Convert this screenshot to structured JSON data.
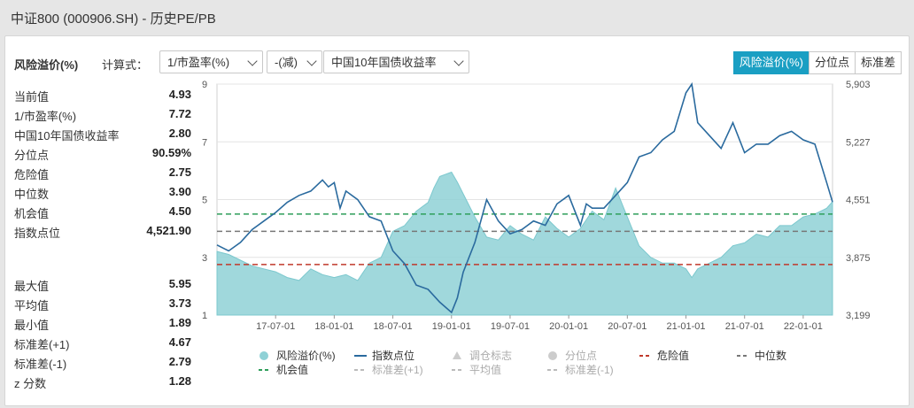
{
  "header": {
    "title": "中证800 (000906.SH) - 历史PE/PB"
  },
  "controls": {
    "metric_label": "风险溢价(%)",
    "formula_label": "计算式：",
    "select1": "1/市盈率(%)",
    "select2": "-(减)",
    "select3": "中国10年国债收益率"
  },
  "tabs": [
    {
      "label": "风险溢价(%)",
      "active": true
    },
    {
      "label": "分位点",
      "active": false
    },
    {
      "label": "标准差",
      "active": false
    }
  ],
  "stats_top": [
    {
      "label": "当前值",
      "value": "4.93"
    },
    {
      "label": "1/市盈率(%)",
      "value": "7.72"
    },
    {
      "label": "中国10年国债收益率",
      "value": "2.80"
    },
    {
      "label": "分位点",
      "value": "90.59%"
    },
    {
      "label": "危险值",
      "value": "2.75"
    },
    {
      "label": "中位数",
      "value": "3.90"
    },
    {
      "label": "机会值",
      "value": "4.50"
    },
    {
      "label": "指数点位",
      "value": "4,521.90"
    }
  ],
  "stats_bottom": [
    {
      "label": "最大值",
      "value": "5.95"
    },
    {
      "label": "平均值",
      "value": "3.73"
    },
    {
      "label": "最小值",
      "value": "1.89"
    },
    {
      "label": "标准差(+1)",
      "value": "4.67"
    },
    {
      "label": "标准差(-1)",
      "value": "2.79"
    },
    {
      "label": "z 分数",
      "value": "1.28"
    }
  ],
  "colors": {
    "area_fill": "#8fd1d6",
    "area_stroke": "#7cc8ce",
    "index_line": "#2a6a9e",
    "danger": "#c0392b",
    "median": "#777777",
    "opportunity": "#2e9e5a",
    "std": "#bbbbbb",
    "tab_active": "#1a9fc3"
  },
  "chart_data": {
    "type": "line",
    "x_ticks": [
      "17-07-01",
      "18-01-01",
      "18-07-01",
      "19-01-01",
      "19-07-01",
      "20-01-01",
      "20-07-01",
      "21-01-01",
      "21-07-01",
      "22-01-01"
    ],
    "x_tick_values": [
      2017.5,
      2018.0,
      2018.5,
      2019.0,
      2019.5,
      2020.0,
      2020.5,
      2021.0,
      2021.5,
      2022.0
    ],
    "xlim": [
      2017.0,
      2022.25
    ],
    "y_left": {
      "ticks": [
        "1",
        "3",
        "5",
        "7",
        "9"
      ],
      "lim": [
        1,
        9
      ]
    },
    "y_right": {
      "ticks": [
        "3,199",
        "3,875",
        "4,551",
        "5,227",
        "5,903"
      ],
      "lim": [
        3199,
        5903
      ]
    },
    "reference_lines": [
      {
        "name": "危险值",
        "value": 2.75,
        "color": "#c0392b"
      },
      {
        "name": "中位数",
        "value": 3.9,
        "color": "#777777"
      },
      {
        "name": "机会值",
        "value": 4.5,
        "color": "#2e9e5a"
      }
    ],
    "series": [
      {
        "name": "风险溢价(%)",
        "axis": "left",
        "x": [
          2017.0,
          2017.1,
          2017.2,
          2017.3,
          2017.4,
          2017.5,
          2017.6,
          2017.7,
          2017.8,
          2017.9,
          2018.0,
          2018.1,
          2018.2,
          2018.3,
          2018.4,
          2018.5,
          2018.6,
          2018.7,
          2018.8,
          2018.85,
          2018.9,
          2019.0,
          2019.05,
          2019.1,
          2019.2,
          2019.3,
          2019.4,
          2019.5,
          2019.6,
          2019.7,
          2019.8,
          2019.9,
          2020.0,
          2020.1,
          2020.2,
          2020.3,
          2020.4,
          2020.5,
          2020.6,
          2020.7,
          2020.8,
          2020.9,
          2021.0,
          2021.05,
          2021.1,
          2021.2,
          2021.3,
          2021.4,
          2021.5,
          2021.6,
          2021.7,
          2021.8,
          2021.9,
          2022.0,
          2022.1,
          2022.2,
          2022.25
        ],
        "values": [
          3.2,
          3.1,
          2.9,
          2.7,
          2.6,
          2.5,
          2.3,
          2.2,
          2.6,
          2.4,
          2.3,
          2.4,
          2.2,
          2.8,
          3.0,
          3.9,
          4.1,
          4.6,
          4.9,
          5.4,
          5.8,
          5.95,
          5.6,
          5.2,
          4.4,
          3.7,
          3.6,
          4.1,
          3.8,
          3.6,
          4.4,
          4.0,
          3.7,
          4.0,
          4.6,
          4.3,
          5.4,
          4.4,
          3.4,
          3.0,
          2.8,
          2.8,
          2.6,
          2.3,
          2.6,
          2.8,
          3.0,
          3.4,
          3.5,
          3.8,
          3.7,
          4.1,
          4.1,
          4.4,
          4.5,
          4.7,
          4.93
        ]
      },
      {
        "name": "指数点位",
        "axis": "right",
        "x": [
          2017.0,
          2017.1,
          2017.2,
          2017.3,
          2017.4,
          2017.5,
          2017.6,
          2017.7,
          2017.8,
          2017.9,
          2017.95,
          2018.0,
          2018.05,
          2018.1,
          2018.2,
          2018.3,
          2018.4,
          2018.5,
          2018.6,
          2018.7,
          2018.8,
          2018.9,
          2019.0,
          2019.05,
          2019.1,
          2019.2,
          2019.3,
          2019.4,
          2019.5,
          2019.6,
          2019.7,
          2019.8,
          2019.9,
          2020.0,
          2020.1,
          2020.15,
          2020.2,
          2020.3,
          2020.4,
          2020.5,
          2020.6,
          2020.7,
          2020.8,
          2020.9,
          2021.0,
          2021.05,
          2021.1,
          2021.2,
          2021.3,
          2021.4,
          2021.5,
          2021.6,
          2021.7,
          2021.8,
          2021.9,
          2022.0,
          2022.1,
          2022.2,
          2022.25
        ],
        "values": [
          4020,
          3950,
          4050,
          4200,
          4300,
          4400,
          4520,
          4600,
          4650,
          4780,
          4700,
          4750,
          4450,
          4650,
          4550,
          4350,
          4300,
          3950,
          3800,
          3550,
          3500,
          3350,
          3230,
          3400,
          3700,
          4050,
          4550,
          4300,
          4150,
          4200,
          4300,
          4250,
          4500,
          4600,
          4250,
          4500,
          4450,
          4450,
          4600,
          4750,
          5050,
          5100,
          5250,
          5350,
          5800,
          5903,
          5450,
          5300,
          5150,
          5450,
          5100,
          5200,
          5200,
          5300,
          5350,
          5250,
          5200,
          4750,
          4522
        ]
      }
    ],
    "legend": [
      {
        "label": "风险溢价(%)",
        "kind": "dot",
        "color": "#8fd1d6",
        "active": true
      },
      {
        "label": "指数点位",
        "kind": "line",
        "color": "#2a6a9e",
        "active": true
      },
      {
        "label": "调仓标志",
        "kind": "triangle",
        "color": "#cccccc",
        "active": false
      },
      {
        "label": "分位点",
        "kind": "dot",
        "color": "#cccccc",
        "active": false
      },
      {
        "label": "危险值",
        "kind": "dash",
        "color": "#c0392b",
        "active": true
      },
      {
        "label": "中位数",
        "kind": "dash",
        "color": "#777777",
        "active": true
      },
      {
        "label": "机会值",
        "kind": "dash",
        "color": "#2e9e5a",
        "active": true
      },
      {
        "label": "标准差(+1)",
        "kind": "dash",
        "color": "#bbbbbb",
        "active": false
      },
      {
        "label": "平均值",
        "kind": "dash",
        "color": "#bbbbbb",
        "active": false
      },
      {
        "label": "标准差(-1)",
        "kind": "dash",
        "color": "#bbbbbb",
        "active": false
      }
    ],
    "grid": true
  }
}
